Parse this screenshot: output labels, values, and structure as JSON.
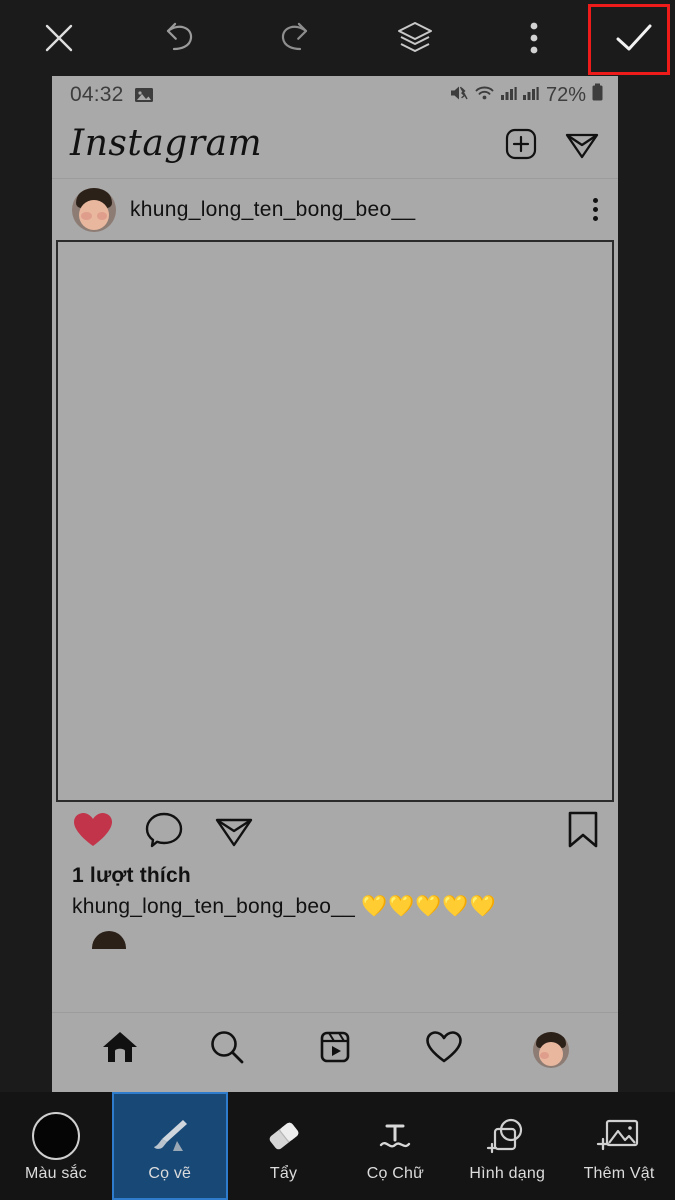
{
  "editor": {
    "toolbar": [
      {
        "name": "close",
        "label": "Close",
        "icon": "close-icon"
      },
      {
        "name": "undo",
        "label": "Undo",
        "icon": "undo-icon"
      },
      {
        "name": "redo",
        "label": "Redo",
        "icon": "redo-icon"
      },
      {
        "name": "layers",
        "label": "Layers",
        "icon": "layers-icon"
      },
      {
        "name": "more",
        "label": "More options",
        "icon": "more-vertical-icon"
      },
      {
        "name": "confirm",
        "label": "Done",
        "icon": "check-icon"
      }
    ],
    "highlight_color": "#ee1b1b",
    "highlighted_control": "confirm",
    "tools": [
      {
        "id": "color",
        "label": "Màu sắc",
        "icon": "color-circle-icon",
        "selected": false
      },
      {
        "id": "brush",
        "label": "Cọ vẽ",
        "icon": "paint-brush-icon",
        "selected": true
      },
      {
        "id": "eraser",
        "label": "Tẩy",
        "icon": "eraser-icon",
        "selected": false
      },
      {
        "id": "text",
        "label": "Cọ Chữ",
        "icon": "text-brush-icon",
        "selected": false
      },
      {
        "id": "shape",
        "label": "Hình dạng",
        "icon": "add-shape-icon",
        "selected": false
      },
      {
        "id": "object",
        "label": "Thêm Vật",
        "icon": "add-image-icon",
        "selected": false
      }
    ],
    "accent_color": "#2f7ccd",
    "selected_tool_bg": "#174876"
  },
  "phone": {
    "status_bar": {
      "time": "04:32",
      "battery_percent": "72%",
      "icons": [
        "screenshot-image-icon",
        "mute-vibrate-icon",
        "wifi-icon",
        "signal-bars-icon",
        "signal-bars-icon",
        "battery-icon"
      ]
    },
    "instagram": {
      "logo": "Instagram",
      "header_actions": [
        "add-post-icon",
        "direct-message-icon"
      ],
      "post": {
        "username": "khung_long_ten_bong_beo__",
        "more_menu": "more-vertical-icon",
        "media_placeholder": "",
        "actions": {
          "like": {
            "icon": "heart-filled-icon",
            "liked": true,
            "color": "#c2344a"
          },
          "comment": {
            "icon": "comment-icon"
          },
          "share": {
            "icon": "share-icon"
          },
          "save": {
            "icon": "bookmark-icon"
          }
        },
        "likes_text": "1 lượt thích",
        "caption_author": "khung_long_ten_bong_beo__",
        "caption_emoji": "💛💛💛💛💛"
      },
      "bottom_nav": [
        {
          "id": "home",
          "icon": "home-filled-icon",
          "active": true
        },
        {
          "id": "search",
          "icon": "search-icon",
          "active": false
        },
        {
          "id": "reels",
          "icon": "reels-icon",
          "active": false
        },
        {
          "id": "activity",
          "icon": "heart-outline-icon",
          "active": false
        },
        {
          "id": "profile",
          "icon": "profile-avatar",
          "active": false
        }
      ]
    }
  }
}
